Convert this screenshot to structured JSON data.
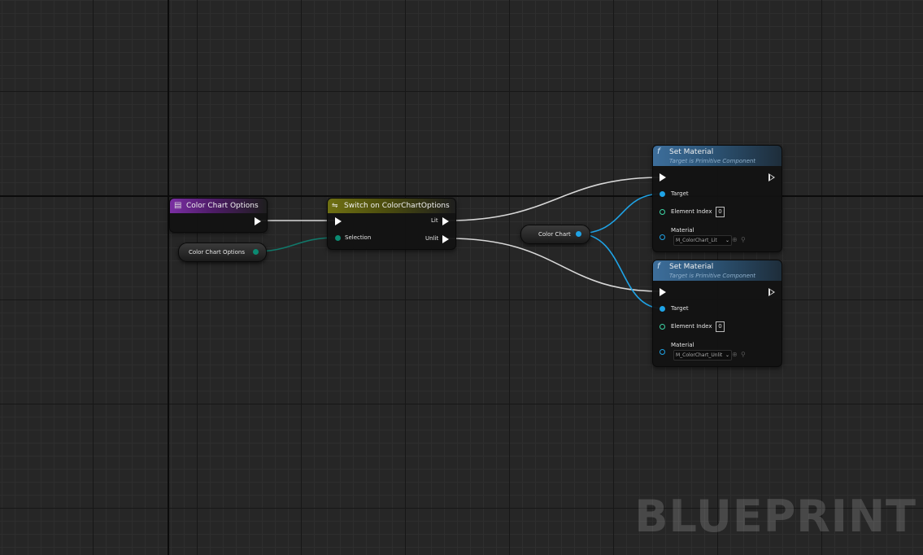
{
  "watermark": "BLUEPRINT",
  "nodes": {
    "enum_event": {
      "title": "Color Chart Options",
      "color": "#7a2ea3"
    },
    "enum_var": {
      "label": "Color Chart Options"
    },
    "switch": {
      "title": "Switch on ColorChartOptions",
      "selection_label": "Selection",
      "out_lit": "Lit",
      "out_unlit": "Unlit",
      "color": "#6f7013"
    },
    "color_chart_var": {
      "label": "Color Chart"
    },
    "set_material": [
      {
        "title": "Set Material",
        "subtitle": "Target is Primitive Component",
        "target_label": "Target",
        "element_index_label": "Element Index",
        "element_index_value": "0",
        "material_label": "Material",
        "material_value": "M_ColorChart_Lit"
      },
      {
        "title": "Set Material",
        "subtitle": "Target is Primitive Component",
        "target_label": "Target",
        "element_index_label": "Element Index",
        "element_index_value": "0",
        "material_label": "Material",
        "material_value": "M_ColorChart_Unlit"
      }
    ]
  },
  "icons": {
    "enum": "enum-icon",
    "switch": "switch-icon",
    "function": "function-icon",
    "dropdown": "chevron-down-icon",
    "use": "arrow-circle-icon",
    "browse": "search-icon"
  },
  "colors": {
    "object_pin": "#1fa3e6",
    "enum_pin": "#0b8a72",
    "int_pin": "#3ed6a6",
    "material_pin": "#1fa3e6",
    "exec": "#ffffff"
  }
}
